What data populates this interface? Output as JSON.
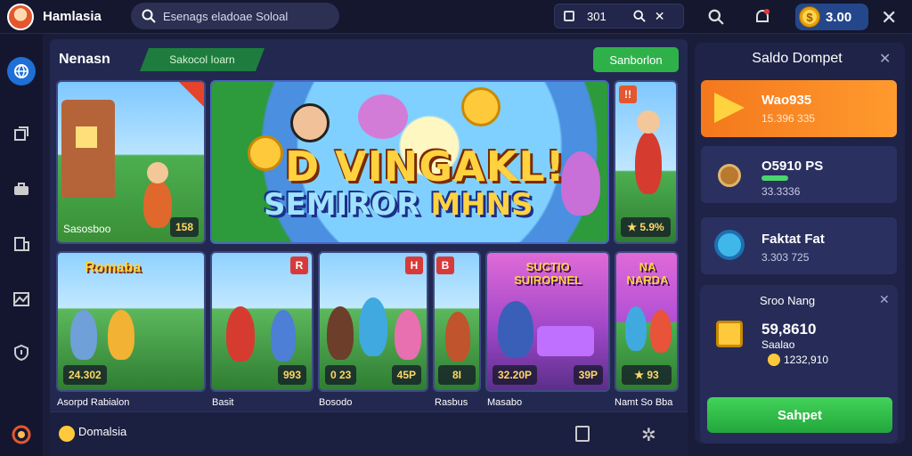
{
  "app": {
    "brand": "Hamlasia"
  },
  "search": {
    "text": "Esenags  eladoae  Soloal"
  },
  "filter": {
    "count": "301"
  },
  "wallet_pill": {
    "amount": "3.00"
  },
  "section": {
    "title": "Nenasn",
    "tag": "Sakocol Ioarn",
    "action": "Sanborlon"
  },
  "cards": [
    {
      "label": "Sasosboo",
      "badge": "158"
    },
    {
      "badge": "★ 5.9%"
    },
    {
      "title": "Romaba",
      "badge": "24.302"
    },
    {
      "badge": "993"
    },
    {
      "badge": "0 23"
    },
    {
      "badge": "45P"
    },
    {
      "badge": "8I"
    },
    {
      "title": "SUCTIO SUIROPNEL",
      "badge": "32.20P"
    },
    {
      "badge": "39P"
    },
    {
      "title": "NA NARDA",
      "badge": "★ 93"
    }
  ],
  "banner": {
    "line1": "D VINGAKL!",
    "line2_a": "SEMIROR",
    "line2_b": "MHNS"
  },
  "captions": [
    "Asorpd Rabialon",
    "Basit",
    "Bosodo",
    "Rasbus",
    "Masabo",
    "Namt So Bba"
  ],
  "footer": {
    "label": "Domalsia"
  },
  "panel": {
    "title": "Saldo Dompet",
    "items": [
      {
        "value": "Wao935",
        "sub": "15.396 335"
      },
      {
        "value": "O5910 PS",
        "sub": "33.3336"
      },
      {
        "value": "Faktat Fat",
        "sub": "3.303 725"
      }
    ],
    "sub_title": "Sroo Nang",
    "amount": "59,8610",
    "amount_sub": "Saalao",
    "coin_value": "1232,910",
    "button": "Sahpet"
  },
  "colors": {
    "accent": "#2fb14a",
    "orange": "#f4781c",
    "bg": "#1a1d3a"
  }
}
